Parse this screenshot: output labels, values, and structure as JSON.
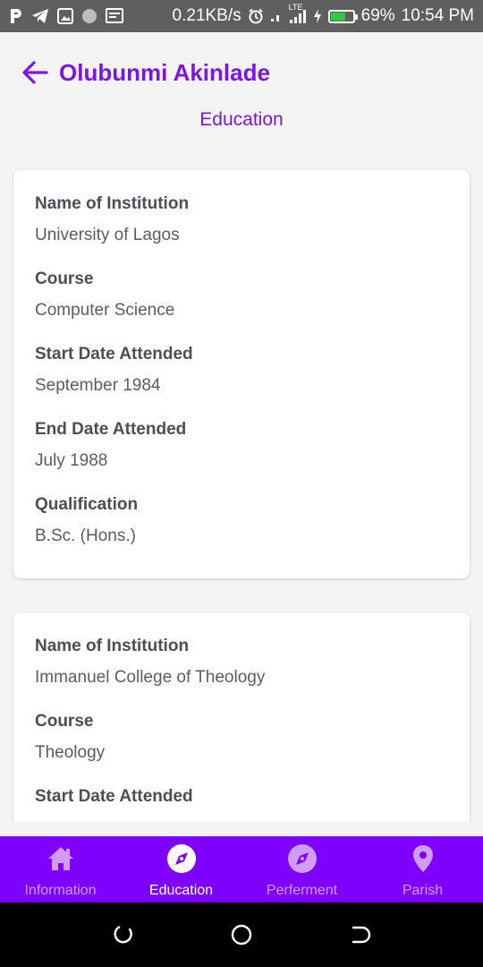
{
  "status_bar": {
    "left_icons": [
      "p-app-icon",
      "telegram-icon",
      "gallery-icon",
      "dot-icon",
      "screen-icon"
    ],
    "speed": "0.21KB/s",
    "network": "LTE",
    "battery": "69%",
    "battery_level": 0.69,
    "time": "10:54 PM"
  },
  "header": {
    "back_icon": "arrow-left-icon",
    "person_name": "Olubunmi Akinlade",
    "section_title": "Education"
  },
  "education": [
    {
      "fields": [
        {
          "label": "Name of Institution",
          "value": "University of Lagos"
        },
        {
          "label": "Course",
          "value": "Computer Science"
        },
        {
          "label": "Start Date Attended",
          "value": "September 1984"
        },
        {
          "label": "End Date Attended",
          "value": "July 1988"
        },
        {
          "label": "Qualification",
          "value": "B.Sc. (Hons.)"
        }
      ]
    },
    {
      "fields": [
        {
          "label": "Name of Institution",
          "value": "Immanuel College of Theology"
        },
        {
          "label": "Course",
          "value": "Theology"
        },
        {
          "label": "Start Date Attended",
          "value": ""
        }
      ]
    }
  ],
  "bottom_nav": {
    "active": "Education",
    "items": [
      {
        "label": "Information",
        "icon": "home-icon"
      },
      {
        "label": "Education",
        "icon": "compass-icon"
      },
      {
        "label": "Perferment",
        "icon": "compass-icon"
      },
      {
        "label": "Parish",
        "icon": "location-pin-icon"
      }
    ]
  },
  "system_nav": [
    "recent-apps-icon",
    "home-circle-icon",
    "back-icon"
  ],
  "colors": {
    "accent": "#7b14e6",
    "nav_background": "#7e00ff",
    "nav_inactive": "#cf9dff",
    "status_bar": "#5f5f5f",
    "battery_fill": "#2ecc40"
  }
}
